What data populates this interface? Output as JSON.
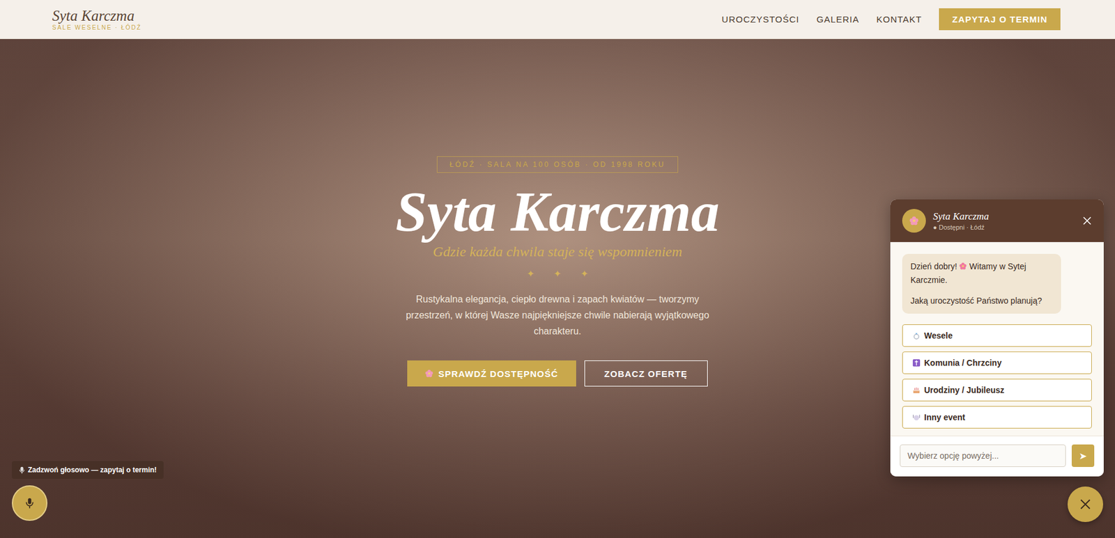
{
  "nav": {
    "logo": "Syta Karczma",
    "tagline": "SALE WESELNE · ŁÓDŹ",
    "links": [
      "UROCZYSTOŚCI",
      "GALERIA",
      "KONTAKT"
    ],
    "cta": "ZAPYTAJ O TERMIN"
  },
  "hero": {
    "badge": "ŁÓDŹ · SALA NA 100 OSÓB · OD 1998 ROKU",
    "title": "Syta Karczma",
    "subtitle": "Gdzie każda chwila staje się wspomnieniem",
    "ornaments": [
      "✦",
      "✦",
      "✦"
    ],
    "description": "Rustykalna elegancja, ciepło drewna i zapach kwiatów — tworzymy przestrzeń, w której Wasze najpiękniejsze chwile nabierają wyjątkowego charakteru.",
    "buttons": [
      {
        "label": "SPRAWDŹ DOSTĘPNOŚĆ",
        "kind": "primary"
      },
      {
        "label": "ZOBACZ OFERTĘ",
        "kind": "outline"
      }
    ]
  },
  "chat": {
    "name": "Syta Karczma",
    "status": "● Dostępni · Łódź",
    "message": {
      "before": "Dzień dobry!",
      "after": "Witamy w Sytej Karczmie.",
      "question": "Jaką uroczystość Państwo planują?"
    },
    "options": [
      {
        "label": "Wesele",
        "kind": "ring"
      },
      {
        "label": "Komunia / Chrzciny",
        "kind": "cross"
      },
      {
        "label": "Urodziny / Jubileusz",
        "kind": "cake"
      },
      {
        "label": "Inny event",
        "kind": "plate"
      }
    ],
    "input_placeholder": "Wybierz opcję powyżej...",
    "send": "➤"
  },
  "voice": {
    "tooltip": "Zadzwoń głosowo — zapytaj o termin!"
  }
}
